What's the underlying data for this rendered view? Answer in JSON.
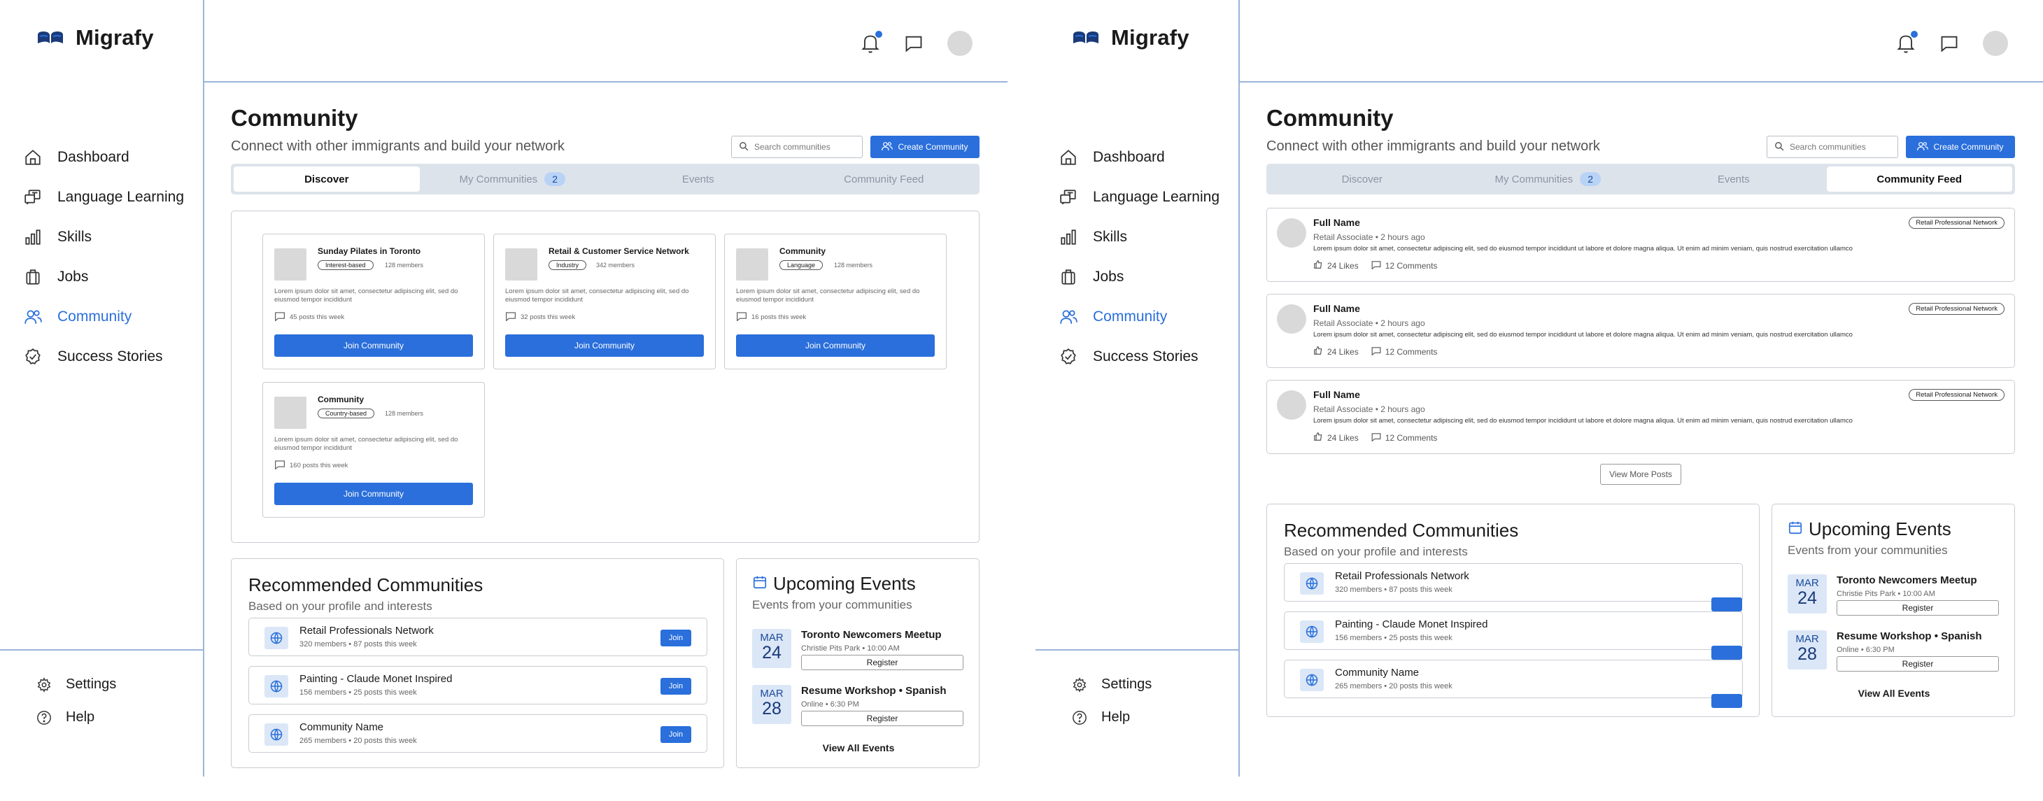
{
  "app": {
    "name": "Migrafy"
  },
  "nav": {
    "items": [
      {
        "label": "Dashboard",
        "icon": "home-icon"
      },
      {
        "label": "Language Learning",
        "icon": "language-icon"
      },
      {
        "label": "Skills",
        "icon": "chart-icon"
      },
      {
        "label": "Jobs",
        "icon": "briefcase-icon"
      },
      {
        "label": "Community",
        "icon": "users-icon",
        "active": true
      },
      {
        "label": "Success Stories",
        "icon": "badge-check-icon"
      }
    ],
    "bottom": [
      {
        "label": "Settings",
        "icon": "gear-icon"
      },
      {
        "label": "Help",
        "icon": "help-icon"
      }
    ]
  },
  "page": {
    "title": "Community",
    "subtitle": "Connect with other immigrants and build your network",
    "search_placeholder": "Search communities",
    "create_label": "Create Community"
  },
  "tabs": [
    {
      "label": "Discover"
    },
    {
      "label": "My Communities",
      "badge": "2"
    },
    {
      "label": "Events"
    },
    {
      "label": "Community Feed"
    }
  ],
  "communities": [
    {
      "name": "Sunday Pilates in Toronto",
      "tag": "Interest-based",
      "members": "128 members",
      "desc": "Lorem ipsum dolor sit amet, consectetur adipiscing elit, sed do eiusmod tempor incididunt",
      "posts": "45 posts this week",
      "join": "Join Community"
    },
    {
      "name": "Retail & Customer Service Network",
      "tag": "Industry",
      "members": "342 members",
      "desc": "Lorem ipsum dolor sit amet, consectetur adipiscing elit, sed do eiusmod tempor incididunt",
      "posts": "32 posts this week",
      "join": "Join Community"
    },
    {
      "name": "Community",
      "tag": "Language",
      "members": "128 members",
      "desc": "Lorem ipsum dolor sit amet, consectetur adipiscing elit, sed do eiusmod tempor incididunt",
      "posts": "16 posts this week",
      "join": "Join Community"
    },
    {
      "name": "Community",
      "tag": "Country-based",
      "members": "128 members",
      "desc": "Lorem ipsum dolor sit amet, consectetur adipiscing elit, sed do eiusmod tempor incididunt",
      "posts": "160 posts this week",
      "join": "Join Community"
    }
  ],
  "recommended": {
    "title": "Recommended Communities",
    "subtitle": "Based on your profile and interests",
    "join_label": "Join",
    "items": [
      {
        "name": "Retail Professionals Network",
        "meta": "320 members • 87 posts this week"
      },
      {
        "name": "Painting - Claude Monet Inspired",
        "meta": "156 members • 25 posts this week"
      },
      {
        "name": "Community Name",
        "meta": "265 members • 20 posts this week"
      }
    ]
  },
  "events": {
    "title": "Upcoming Events",
    "subtitle": "Events from your communities",
    "register_label": "Register",
    "view_all": "View All Events",
    "items": [
      {
        "month": "MAR",
        "day": "24",
        "name": "Toronto Newcomers Meetup",
        "meta": "Christie Pits Park • 10:00 AM"
      },
      {
        "month": "MAR",
        "day": "28",
        "name": "Resume Workshop • Spanish",
        "meta": "Online • 6:30 PM"
      }
    ]
  },
  "feed": {
    "posts": [
      {
        "name": "Full Name",
        "role": "Retail Associate • 2 hours ago",
        "text": "Lorem ipsum dolor sit amet, consectetur adipiscing elit, sed do eiusmod tempor incididunt ut labore et dolore magna aliqua. Ut enim ad minim veniam, quis nostrud exercitation ullamco",
        "tag": "Retail Professional Network",
        "likes": "24 Likes",
        "comments": "12 Comments"
      },
      {
        "name": "Full Name",
        "role": "Retail Associate • 2 hours ago",
        "text": "Lorem ipsum dolor sit amet, consectetur adipiscing elit, sed do eiusmod tempor incididunt ut labore et dolore magna aliqua. Ut enim ad minim veniam, quis nostrud exercitation ullamco",
        "tag": "Retail Professional Network",
        "likes": "24 Likes",
        "comments": "12 Comments"
      },
      {
        "name": "Full Name",
        "role": "Retail Associate • 2 hours ago",
        "text": "Lorem ipsum dolor sit amet, consectetur adipiscing elit, sed do eiusmod tempor incididunt ut labore et dolore magna aliqua. Ut enim ad minim veniam, quis nostrud exercitation ullamco",
        "tag": "Retail Professional Network",
        "likes": "24 Likes",
        "comments": "12 Comments"
      }
    ],
    "view_more": "View More Posts"
  },
  "colors": {
    "accent": "#2a6fdb",
    "divider": "#9ab4db",
    "tab_bg": "#dde3eb"
  }
}
